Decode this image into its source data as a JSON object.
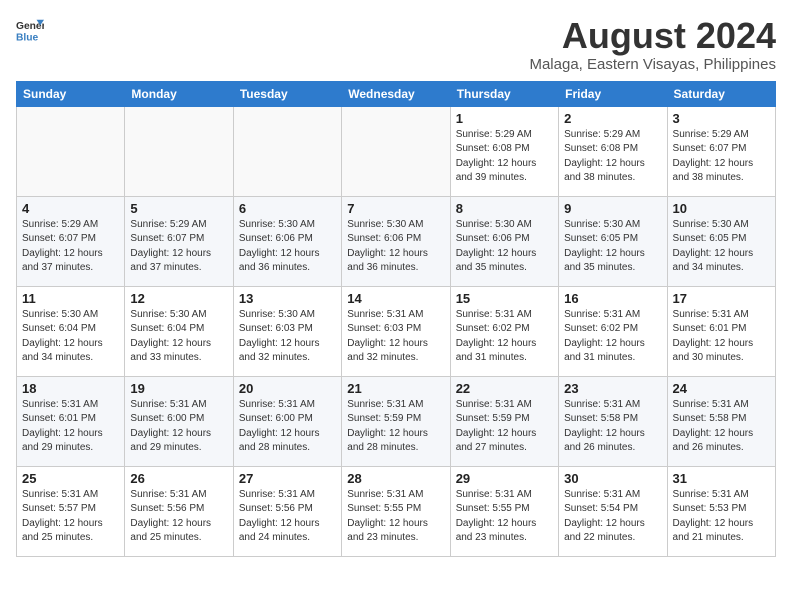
{
  "header": {
    "logo_general": "General",
    "logo_blue": "Blue",
    "title": "August 2024",
    "subtitle": "Malaga, Eastern Visayas, Philippines"
  },
  "weekdays": [
    "Sunday",
    "Monday",
    "Tuesday",
    "Wednesday",
    "Thursday",
    "Friday",
    "Saturday"
  ],
  "weeks": [
    [
      {
        "day": "",
        "info": ""
      },
      {
        "day": "",
        "info": ""
      },
      {
        "day": "",
        "info": ""
      },
      {
        "day": "",
        "info": ""
      },
      {
        "day": "1",
        "info": "Sunrise: 5:29 AM\nSunset: 6:08 PM\nDaylight: 12 hours\nand 39 minutes."
      },
      {
        "day": "2",
        "info": "Sunrise: 5:29 AM\nSunset: 6:08 PM\nDaylight: 12 hours\nand 38 minutes."
      },
      {
        "day": "3",
        "info": "Sunrise: 5:29 AM\nSunset: 6:07 PM\nDaylight: 12 hours\nand 38 minutes."
      }
    ],
    [
      {
        "day": "4",
        "info": "Sunrise: 5:29 AM\nSunset: 6:07 PM\nDaylight: 12 hours\nand 37 minutes."
      },
      {
        "day": "5",
        "info": "Sunrise: 5:29 AM\nSunset: 6:07 PM\nDaylight: 12 hours\nand 37 minutes."
      },
      {
        "day": "6",
        "info": "Sunrise: 5:30 AM\nSunset: 6:06 PM\nDaylight: 12 hours\nand 36 minutes."
      },
      {
        "day": "7",
        "info": "Sunrise: 5:30 AM\nSunset: 6:06 PM\nDaylight: 12 hours\nand 36 minutes."
      },
      {
        "day": "8",
        "info": "Sunrise: 5:30 AM\nSunset: 6:06 PM\nDaylight: 12 hours\nand 35 minutes."
      },
      {
        "day": "9",
        "info": "Sunrise: 5:30 AM\nSunset: 6:05 PM\nDaylight: 12 hours\nand 35 minutes."
      },
      {
        "day": "10",
        "info": "Sunrise: 5:30 AM\nSunset: 6:05 PM\nDaylight: 12 hours\nand 34 minutes."
      }
    ],
    [
      {
        "day": "11",
        "info": "Sunrise: 5:30 AM\nSunset: 6:04 PM\nDaylight: 12 hours\nand 34 minutes."
      },
      {
        "day": "12",
        "info": "Sunrise: 5:30 AM\nSunset: 6:04 PM\nDaylight: 12 hours\nand 33 minutes."
      },
      {
        "day": "13",
        "info": "Sunrise: 5:30 AM\nSunset: 6:03 PM\nDaylight: 12 hours\nand 32 minutes."
      },
      {
        "day": "14",
        "info": "Sunrise: 5:31 AM\nSunset: 6:03 PM\nDaylight: 12 hours\nand 32 minutes."
      },
      {
        "day": "15",
        "info": "Sunrise: 5:31 AM\nSunset: 6:02 PM\nDaylight: 12 hours\nand 31 minutes."
      },
      {
        "day": "16",
        "info": "Sunrise: 5:31 AM\nSunset: 6:02 PM\nDaylight: 12 hours\nand 31 minutes."
      },
      {
        "day": "17",
        "info": "Sunrise: 5:31 AM\nSunset: 6:01 PM\nDaylight: 12 hours\nand 30 minutes."
      }
    ],
    [
      {
        "day": "18",
        "info": "Sunrise: 5:31 AM\nSunset: 6:01 PM\nDaylight: 12 hours\nand 29 minutes."
      },
      {
        "day": "19",
        "info": "Sunrise: 5:31 AM\nSunset: 6:00 PM\nDaylight: 12 hours\nand 29 minutes."
      },
      {
        "day": "20",
        "info": "Sunrise: 5:31 AM\nSunset: 6:00 PM\nDaylight: 12 hours\nand 28 minutes."
      },
      {
        "day": "21",
        "info": "Sunrise: 5:31 AM\nSunset: 5:59 PM\nDaylight: 12 hours\nand 28 minutes."
      },
      {
        "day": "22",
        "info": "Sunrise: 5:31 AM\nSunset: 5:59 PM\nDaylight: 12 hours\nand 27 minutes."
      },
      {
        "day": "23",
        "info": "Sunrise: 5:31 AM\nSunset: 5:58 PM\nDaylight: 12 hours\nand 26 minutes."
      },
      {
        "day": "24",
        "info": "Sunrise: 5:31 AM\nSunset: 5:58 PM\nDaylight: 12 hours\nand 26 minutes."
      }
    ],
    [
      {
        "day": "25",
        "info": "Sunrise: 5:31 AM\nSunset: 5:57 PM\nDaylight: 12 hours\nand 25 minutes."
      },
      {
        "day": "26",
        "info": "Sunrise: 5:31 AM\nSunset: 5:56 PM\nDaylight: 12 hours\nand 25 minutes."
      },
      {
        "day": "27",
        "info": "Sunrise: 5:31 AM\nSunset: 5:56 PM\nDaylight: 12 hours\nand 24 minutes."
      },
      {
        "day": "28",
        "info": "Sunrise: 5:31 AM\nSunset: 5:55 PM\nDaylight: 12 hours\nand 23 minutes."
      },
      {
        "day": "29",
        "info": "Sunrise: 5:31 AM\nSunset: 5:55 PM\nDaylight: 12 hours\nand 23 minutes."
      },
      {
        "day": "30",
        "info": "Sunrise: 5:31 AM\nSunset: 5:54 PM\nDaylight: 12 hours\nand 22 minutes."
      },
      {
        "day": "31",
        "info": "Sunrise: 5:31 AM\nSunset: 5:53 PM\nDaylight: 12 hours\nand 21 minutes."
      }
    ]
  ]
}
